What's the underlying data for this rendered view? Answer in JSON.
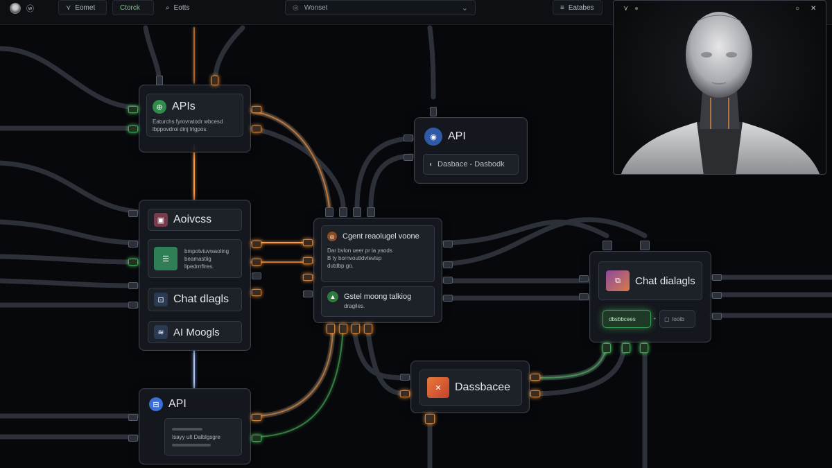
{
  "topbar": {
    "logo_text": "ⓦ",
    "btn_1": "Eomet",
    "btn_2": "Ctorck",
    "btn_3": "Eotts",
    "dropdown_value": "Wonset",
    "btn_right": "Eatabes"
  },
  "nodes": {
    "apis": {
      "title": "APIs",
      "desc": "Eaturchs fyrovratodr wbcesd\nlbppovdroi dinj lrlgpos."
    },
    "advcss": {
      "title": "Aoivcss",
      "desc": "bmpotvtuvwaoling\nbeamastiig\nlipedrrrflres.",
      "chat": "Chat dlagls",
      "models": "AI Moogls"
    },
    "api_bottom": {
      "title": "API",
      "desc": "Isayy ult Dalblgsgre"
    },
    "api_top": {
      "title": "API",
      "sub": "Dasbace - Dasbodk"
    },
    "center": {
      "title": "Cgent reaolugel voone",
      "desc": "Dar bvlon ueer pr la yaods\nB ty bornvoutldvtevlsp\ndutdbp go.",
      "sub_title": "Gstel moong talkiog",
      "sub_desc": "dragiles."
    },
    "chat_right": {
      "title": "Chat dialagls",
      "badge_1": "dbsbbcees",
      "badge_2": "lootb"
    },
    "database": {
      "title": "Dassbacee"
    }
  },
  "video": {
    "ctrl_left": "⋎",
    "ctrl_min": "○",
    "ctrl_close": "✕"
  },
  "colors": {
    "orange_glow": "#ff9a3c",
    "green_glow": "#56d36a",
    "blue_icon": "#3a6fd8",
    "green_icon": "#3aa35a"
  }
}
